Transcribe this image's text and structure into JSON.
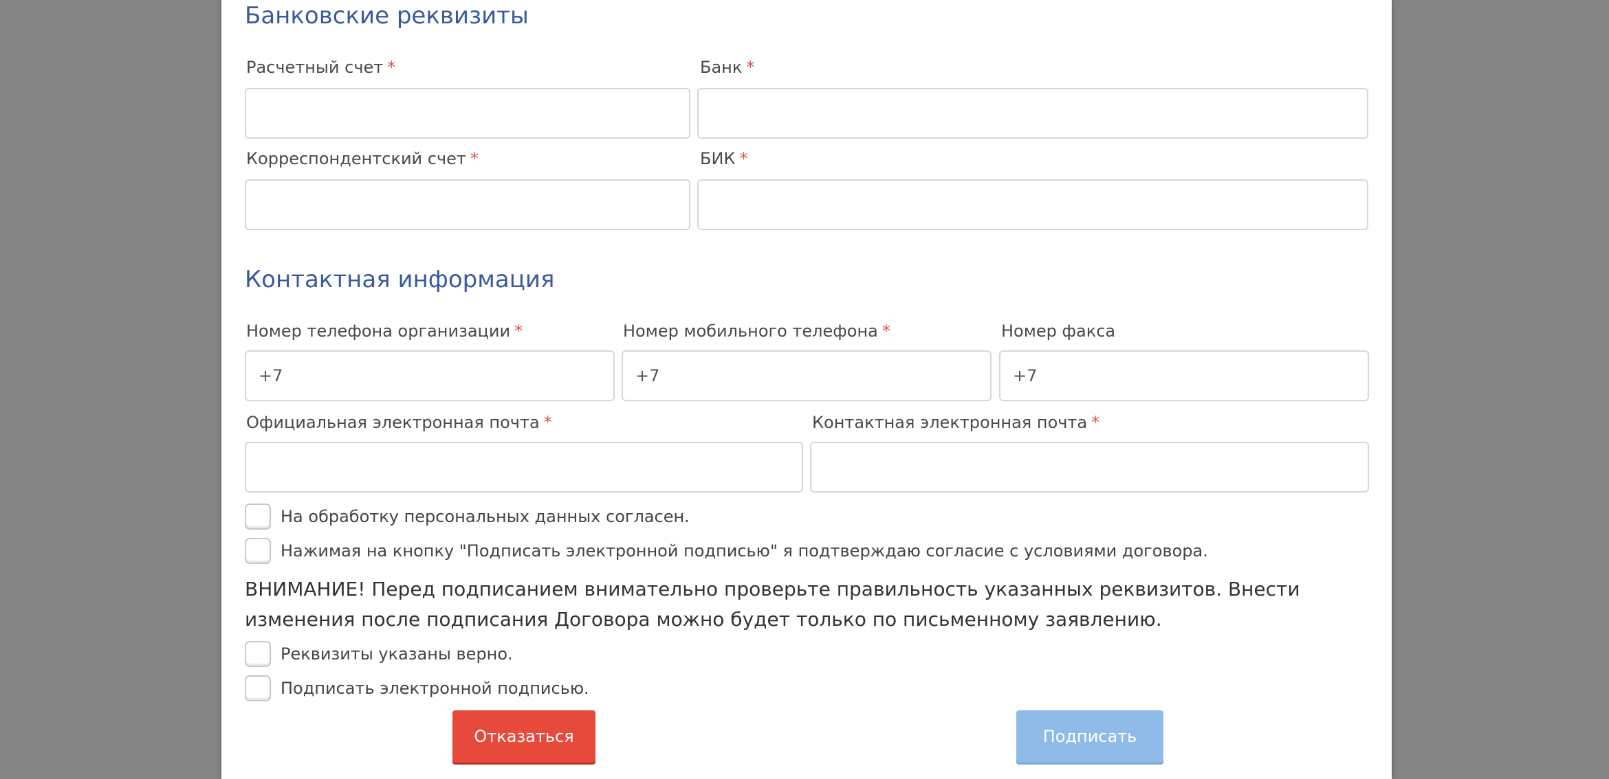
{
  "bank_section": {
    "title": "Банковские реквизиты",
    "fields": {
      "account": {
        "label": "Расчетный счет",
        "required_mark": "*",
        "value": ""
      },
      "bank": {
        "label": "Банк",
        "required_mark": "*",
        "value": ""
      },
      "corr_account": {
        "label": "Корреспондентский счет",
        "required_mark": "*",
        "value": ""
      },
      "bik": {
        "label": "БИК",
        "required_mark": "*",
        "value": ""
      }
    }
  },
  "contact_section": {
    "title": "Контактная информация",
    "fields": {
      "org_phone": {
        "label": "Номер телефона организации",
        "required_mark": "*",
        "value": "+7"
      },
      "mobile_phone": {
        "label": "Номер мобильного телефона",
        "required_mark": "*",
        "value": "+7"
      },
      "fax": {
        "label": "Номер факса",
        "value": "+7"
      },
      "official_email": {
        "label": "Официальная электронная почта",
        "required_mark": "*",
        "value": ""
      },
      "contact_email": {
        "label": "Контактная электронная почта",
        "required_mark": "*",
        "value": ""
      }
    }
  },
  "agreements": {
    "personal_data": "На обработку персональных данных согласен.",
    "sign_consent": "Нажимая на кнопку \"Подписать электронной подписью\" я подтверждаю согласие с условиями договора.",
    "warning": "ВНИМАНИЕ! Перед подписанием внимательно проверьте правильность указанных реквизитов. Внести изменения после подписания Договора можно будет только по письменному заявлению.",
    "requisites_correct": "Реквизиты указаны верно.",
    "sign_electronic": "Подписать электронной подписью."
  },
  "buttons": {
    "decline": "Отказаться",
    "sign": "Подписать"
  },
  "colors": {
    "section_title": "#3a5a9c",
    "required_mark": "#d9534f",
    "decline_button": "#e74a3b",
    "sign_button": "#8fbbe8",
    "backdrop": "#838383"
  }
}
